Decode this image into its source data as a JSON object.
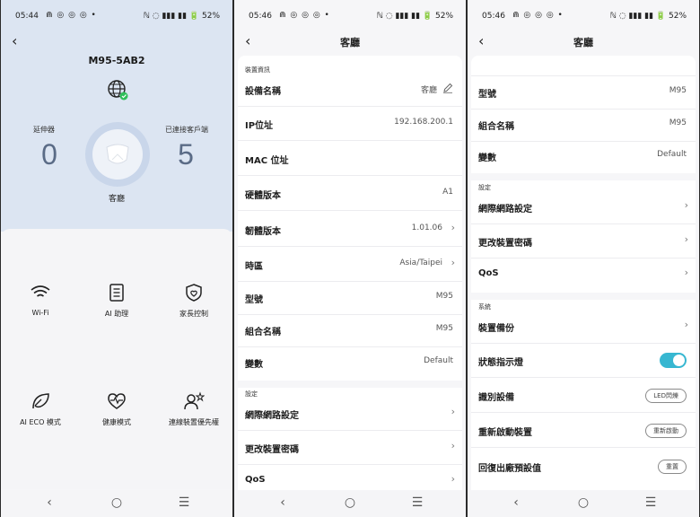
{
  "panel1": {
    "status": {
      "time": "05:44",
      "icons": "⋒ ◎ ◎ ◎ •",
      "right": "ℕ ◌ ▮▮▮ ▮▮ 🔋 52%"
    },
    "device_name": "M95-5AB2",
    "extenders_label": "延伸器",
    "extenders_count": "0",
    "clients_label": "已連接客戶端",
    "clients_count": "5",
    "room": "客廳",
    "tiles": [
      "Wi-Fi",
      "AI 助理",
      "家長控制",
      "AI ECO 模式",
      "健康模式",
      "連線裝置優先權"
    ],
    "icons": [
      "wifi-icon",
      "ai-assistant-icon",
      "parental-control-icon",
      "eco-icon",
      "health-icon",
      "priority-icon"
    ]
  },
  "panel2": {
    "status": {
      "time": "05:46",
      "icons": "⋒ ◎ ◎ ◎ •",
      "right": "ℕ ◌ ▮▮▮ ▮▮ 🔋 52%"
    },
    "title": "客廳",
    "sec_device_info": "裝置資訊",
    "rows": [
      {
        "k": "設備名稱",
        "v": "客廳"
      },
      {
        "k": "IP位址",
        "v": "192.168.200.1"
      },
      {
        "k": "MAC 位址",
        "v": ""
      },
      {
        "k": "硬體版本",
        "v": "A1"
      },
      {
        "k": "韌體版本",
        "v": "1.01.06"
      },
      {
        "k": "時區",
        "v": "Asia/Taipei"
      },
      {
        "k": "型號",
        "v": "M95"
      },
      {
        "k": "組合名稱",
        "v": "M95"
      },
      {
        "k": "變數",
        "v": "Default"
      }
    ],
    "sec_settings": "設定",
    "rows2": [
      {
        "k": "網際網路設定"
      },
      {
        "k": "更改裝置密碼"
      },
      {
        "k": "QoS"
      }
    ]
  },
  "panel3": {
    "status": {
      "time": "05:46",
      "icons": "⋒ ◎ ◎ ◎ •",
      "right": "ℕ ◌ ▮▮▮ ▮▮ 🔋 52%"
    },
    "title": "客廳",
    "rows": [
      {
        "k": "型號",
        "v": "M95"
      },
      {
        "k": "組合名稱",
        "v": "M95"
      },
      {
        "k": "變數",
        "v": "Default"
      }
    ],
    "sec_settings": "設定",
    "rows2": [
      {
        "k": "網際網路設定"
      },
      {
        "k": "更改裝置密碼"
      },
      {
        "k": "QoS"
      }
    ],
    "sec_system": "系統",
    "rows3": [
      {
        "k": "裝置備份"
      },
      {
        "k": "狀態指示燈"
      },
      {
        "k": "識別設備",
        "btn": "LED閃爍"
      },
      {
        "k": "重新啟動裝置",
        "btn": "重新啟動"
      },
      {
        "k": "回復出廠預設值",
        "btn": "重置"
      }
    ]
  },
  "nav": {
    "back": "‹",
    "home": "○",
    "recents": "☰"
  },
  "colors": {
    "accent": "#37b7d1",
    "header_bg": "#dce5f2",
    "count_color": "#5a6b86"
  }
}
